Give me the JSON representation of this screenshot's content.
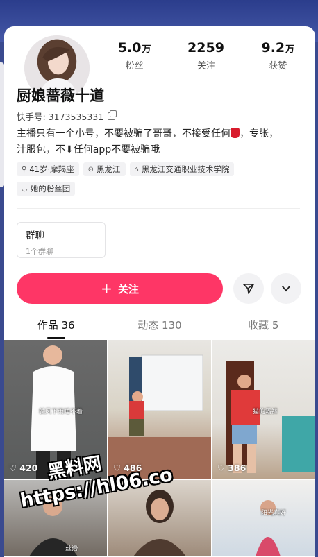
{
  "stats": [
    {
      "value": "5.0",
      "unit": "万",
      "label": "粉丝"
    },
    {
      "value": "2259",
      "unit": "",
      "label": "关注"
    },
    {
      "value": "9.2",
      "unit": "万",
      "label": "获赞"
    }
  ],
  "profile": {
    "name": "厨娘蔷薇十道",
    "kuaishou_id": "快手号: 3173535331",
    "bio_line1_a": "主播只有一个小号，不要被骗了哥哥，不接受任何",
    "bio_line1_b": "，专张，",
    "bio_line2_a": "汁服包，不",
    "bio_line2_b": "任何app不要被骗哦",
    "down_arrow": "⬇"
  },
  "tags": [
    {
      "icon": "age-icon",
      "glyph": "⚲",
      "label": "41岁·摩羯座"
    },
    {
      "icon": "location-icon",
      "glyph": "⊙",
      "label": "黑龙江"
    },
    {
      "icon": "school-icon",
      "glyph": "⌂",
      "label": "黑龙江交通职业技术学院"
    },
    {
      "icon": "fan-group-icon",
      "glyph": "◡",
      "label": "她的粉丝团"
    }
  ],
  "group_chat": {
    "title": "群聊",
    "subtitle": "1个群聊"
  },
  "follow": {
    "plus": "+",
    "label": "关注"
  },
  "tabs": [
    {
      "label": "作品 36",
      "active": true
    },
    {
      "label": "动态 130",
      "active": false
    },
    {
      "label": "收藏 5",
      "active": false
    }
  ],
  "videos": [
    {
      "likes": "420",
      "caption": "就风下雨睡不着"
    },
    {
      "likes": "486",
      "caption": ""
    },
    {
      "likes": "386",
      "caption": "猫的霸裤"
    },
    {
      "likes": "",
      "caption": "丝滑"
    },
    {
      "likes": "",
      "caption": ""
    },
    {
      "likes": "",
      "caption": "阳光真好"
    }
  ],
  "watermark": {
    "line1": "黑料网",
    "line2": "https://hl06.co"
  },
  "colors": {
    "accent": "#fe3666",
    "header": "#2b3d8c"
  }
}
